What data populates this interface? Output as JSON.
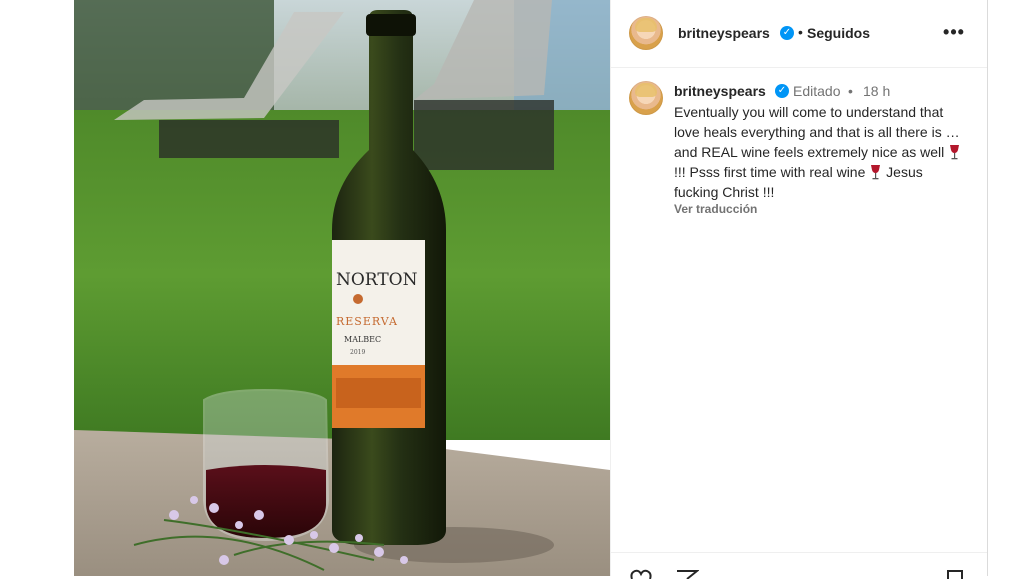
{
  "post": {
    "image_alt": "wine-bottle-photo",
    "bottle_label": {
      "brand": "NORTON",
      "line": "RESERVA",
      "varietal": "MALBEC",
      "vintage": "2019"
    }
  },
  "header": {
    "username": "britneyspears",
    "separator": "•",
    "follow_status": "Seguidos",
    "more_label": "•••"
  },
  "caption": {
    "username": "britneyspears",
    "edited_label": "Editado",
    "separator": "•",
    "time_ago": "18 h",
    "text_part1": "Eventually you will come to understand that love heals everything and that is all there is … and REAL wine feels extremely nice as well ",
    "text_part2": " !!! Psss first time with real wine ",
    "text_part3": " Jesus fucking Christ !!!",
    "see_translation": "Ver traducción"
  },
  "icons": {
    "verified": "verified-badge-icon",
    "wine": "wine-glass-icon",
    "like": "heart-icon",
    "share": "send-icon",
    "save": "bookmark-icon"
  },
  "colors": {
    "verified_blue": "#0095f6",
    "text_primary": "#262626",
    "text_secondary": "#737373",
    "divider": "#efefef"
  }
}
